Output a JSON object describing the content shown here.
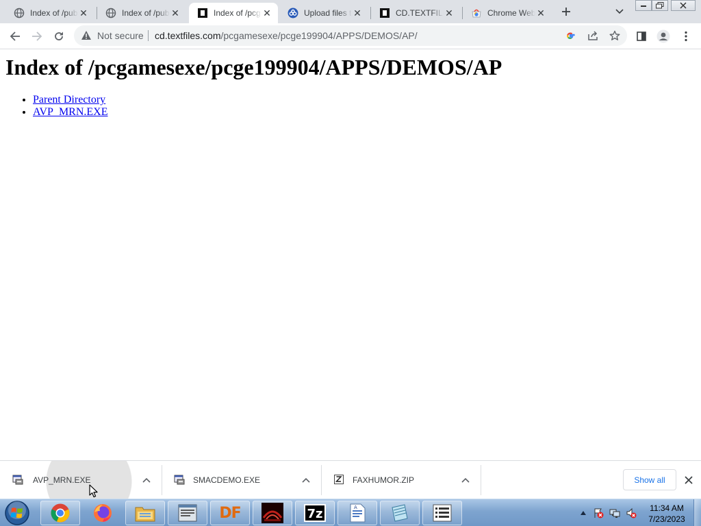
{
  "browser": {
    "tabs": [
      {
        "title": "Index of /pub",
        "favicon": "globe-icon"
      },
      {
        "title": "Index of /pub",
        "favicon": "globe-icon"
      },
      {
        "title": "Index of /pcg",
        "favicon": "textfiles-icon"
      },
      {
        "title": "Upload files t",
        "favicon": "upload-service-icon"
      },
      {
        "title": "CD.TEXTFILES",
        "favicon": "textfiles-icon"
      },
      {
        "title": "Chrome Web",
        "favicon": "chrome-web-store-icon"
      }
    ],
    "active_tab": 2,
    "security_label": "Not secure",
    "url_host": "cd.textfiles.com",
    "url_path": "/pcgamesexe/pcge199904/APPS/DEMOS/AP/",
    "accent_color": "#1a73e8"
  },
  "page": {
    "heading": "Index of /pcgamesexe/pcge199904/APPS/DEMOS/AP",
    "links": [
      {
        "label": "Parent Directory"
      },
      {
        "label": "AVP_MRN.EXE"
      }
    ],
    "link_color": "#0000ee"
  },
  "downloads": {
    "items": [
      {
        "name": "AVP_MRN.EXE",
        "icon": "exe-file-icon"
      },
      {
        "name": "SMACDEMO.EXE",
        "icon": "exe-file-icon"
      },
      {
        "name": "FAXHUMOR.ZIP",
        "icon": "zip-file-icon"
      }
    ],
    "show_all_label": "Show all"
  },
  "taskbar": {
    "apps": [
      {
        "name": "chrome-icon"
      },
      {
        "name": "firefox-icon"
      },
      {
        "name": "file-explorer-icon"
      },
      {
        "name": "document-viewer-icon"
      },
      {
        "name": "df-app-icon",
        "label": "DF"
      },
      {
        "name": "racing-game-icon"
      },
      {
        "name": "7zip-icon",
        "label": "7z"
      },
      {
        "name": "text-document-icon"
      },
      {
        "name": "notepad-icon"
      },
      {
        "name": "list-app-icon"
      }
    ],
    "clock_time": "11:34 AM",
    "clock_date": "7/23/2023"
  }
}
